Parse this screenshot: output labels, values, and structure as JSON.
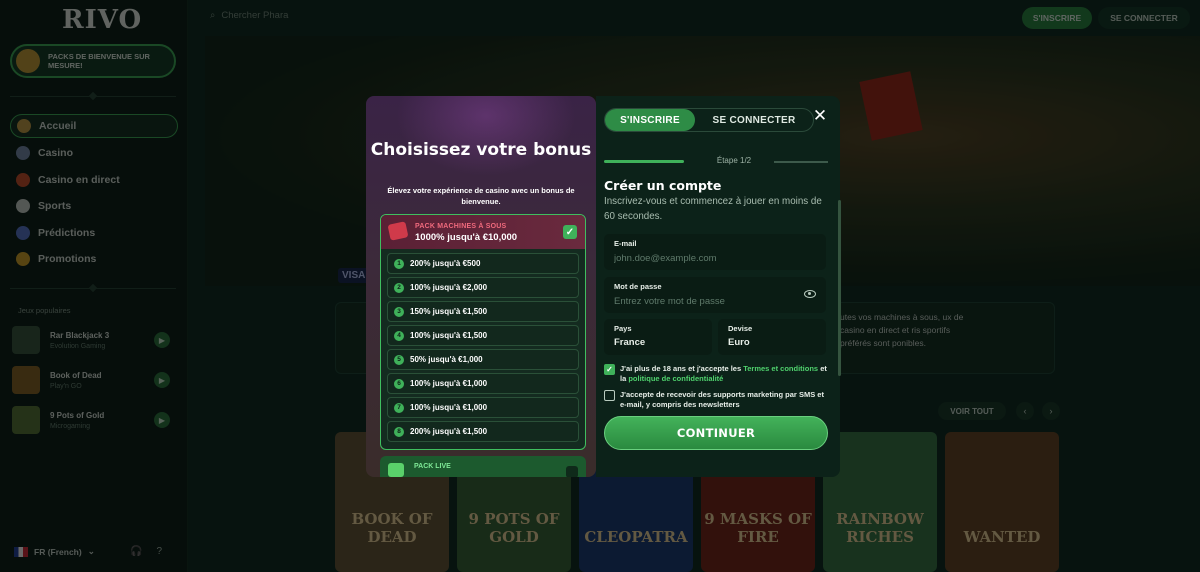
{
  "sidebar": {
    "logo": "RIVO",
    "welcome_pack": "PACKS DE BIENVENUE SUR MESURE!",
    "nav": [
      {
        "label": "Accueil",
        "icon": "home-icon",
        "color": "#c7a04a"
      },
      {
        "label": "Casino",
        "icon": "casino-chip-icon",
        "color": "#7a8fb0"
      },
      {
        "label": "Casino en direct",
        "icon": "live-casino-icon",
        "color": "#c9542f"
      },
      {
        "label": "Sports",
        "icon": "soccer-ball-icon",
        "color": "#c9d2cd"
      },
      {
        "label": "Prédictions",
        "icon": "predictions-icon",
        "color": "#5a7ad0"
      },
      {
        "label": "Promotions",
        "icon": "coin-icon",
        "color": "#d4a52c"
      }
    ],
    "popular_label": "Jeux populaires",
    "games": [
      {
        "name": "Rar Blackjack 3",
        "provider": "Evolution Gaming",
        "play": "▶"
      },
      {
        "name": "Book of Dead",
        "provider": "Play'n GO",
        "play": "▶"
      },
      {
        "name": "9 Pots of Gold",
        "provider": "Microgaming",
        "play": "▶"
      }
    ],
    "language": "FR (French)",
    "language_chevron": "⌄",
    "support_icon": "🎧",
    "help_icon": "?"
  },
  "header": {
    "search_placeholder": "Chercher Phara",
    "signup": "S'INSCRIRE",
    "login": "SE CONNECTER"
  },
  "background": {
    "visa": "VISA",
    "promo_text": "utes vos machines à sous, ux de casino en direct et ris sportifs préférés sont ponibles.",
    "see_all": "VOIR TOUT",
    "prev": "‹",
    "next": "›",
    "tiles": [
      "BOOK OF DEAD",
      "9 POTS OF GOLD",
      "CLEOPATRA",
      "9 MASKS OF FIRE",
      "RAINBOW RICHES",
      "WANTED"
    ]
  },
  "bonus": {
    "title": "Choisissez votre bonus",
    "subtitle": "Élevez votre expérience de casino avec un bonus de bienvenue.",
    "pack_name": "PACK MACHINES À SOUS",
    "pack_amount": "1000% jusqu'à €10,000",
    "checkmark": "✓",
    "offers": [
      {
        "num": "1",
        "label": "200% jusqu'à €500"
      },
      {
        "num": "2",
        "label": "100% jusqu'à €2,000"
      },
      {
        "num": "3",
        "label": "150% jusqu'à €1,500"
      },
      {
        "num": "4",
        "label": "100% jusqu'à €1,500"
      },
      {
        "num": "5",
        "label": "50% jusqu'à €1,000"
      },
      {
        "num": "6",
        "label": "100% jusqu'à €1,000"
      },
      {
        "num": "7",
        "label": "100% jusqu'à €1,000"
      },
      {
        "num": "8",
        "label": "200% jusqu'à €1,500"
      }
    ],
    "live_pack_name": "PACK LIVE"
  },
  "register": {
    "tab_signup": "S'INSCRIRE",
    "tab_login": "SE CONNECTER",
    "close": "✕",
    "step": "Étape 1/2",
    "step_progress": 0.5,
    "title": "Créer un compte",
    "subtitle": "Inscrivez-vous et commencez à jouer en moins de 60 secondes.",
    "email_label": "E-mail",
    "email_placeholder": "john.doe@example.com",
    "password_label": "Mot de passe",
    "password_placeholder": "Entrez votre mot de passe",
    "country_label": "Pays",
    "country_value": "France",
    "currency_label": "Devise",
    "currency_value": "Euro",
    "terms_prefix": "J'ai plus de 18 ans et j'accepte les ",
    "terms_link": "Termes et conditions",
    "terms_mid": " et la ",
    "privacy_link": "politique de confidentialité",
    "terms_checked": true,
    "marketing_text": "J'accepte de recevoir des supports marketing par SMS et e-mail, y compris des newsletters",
    "marketing_checked": false,
    "continue": "CONTINUER"
  },
  "colors": {
    "accent": "#3fb15a",
    "panel": "#0c2219",
    "link": "#4fd16d"
  }
}
